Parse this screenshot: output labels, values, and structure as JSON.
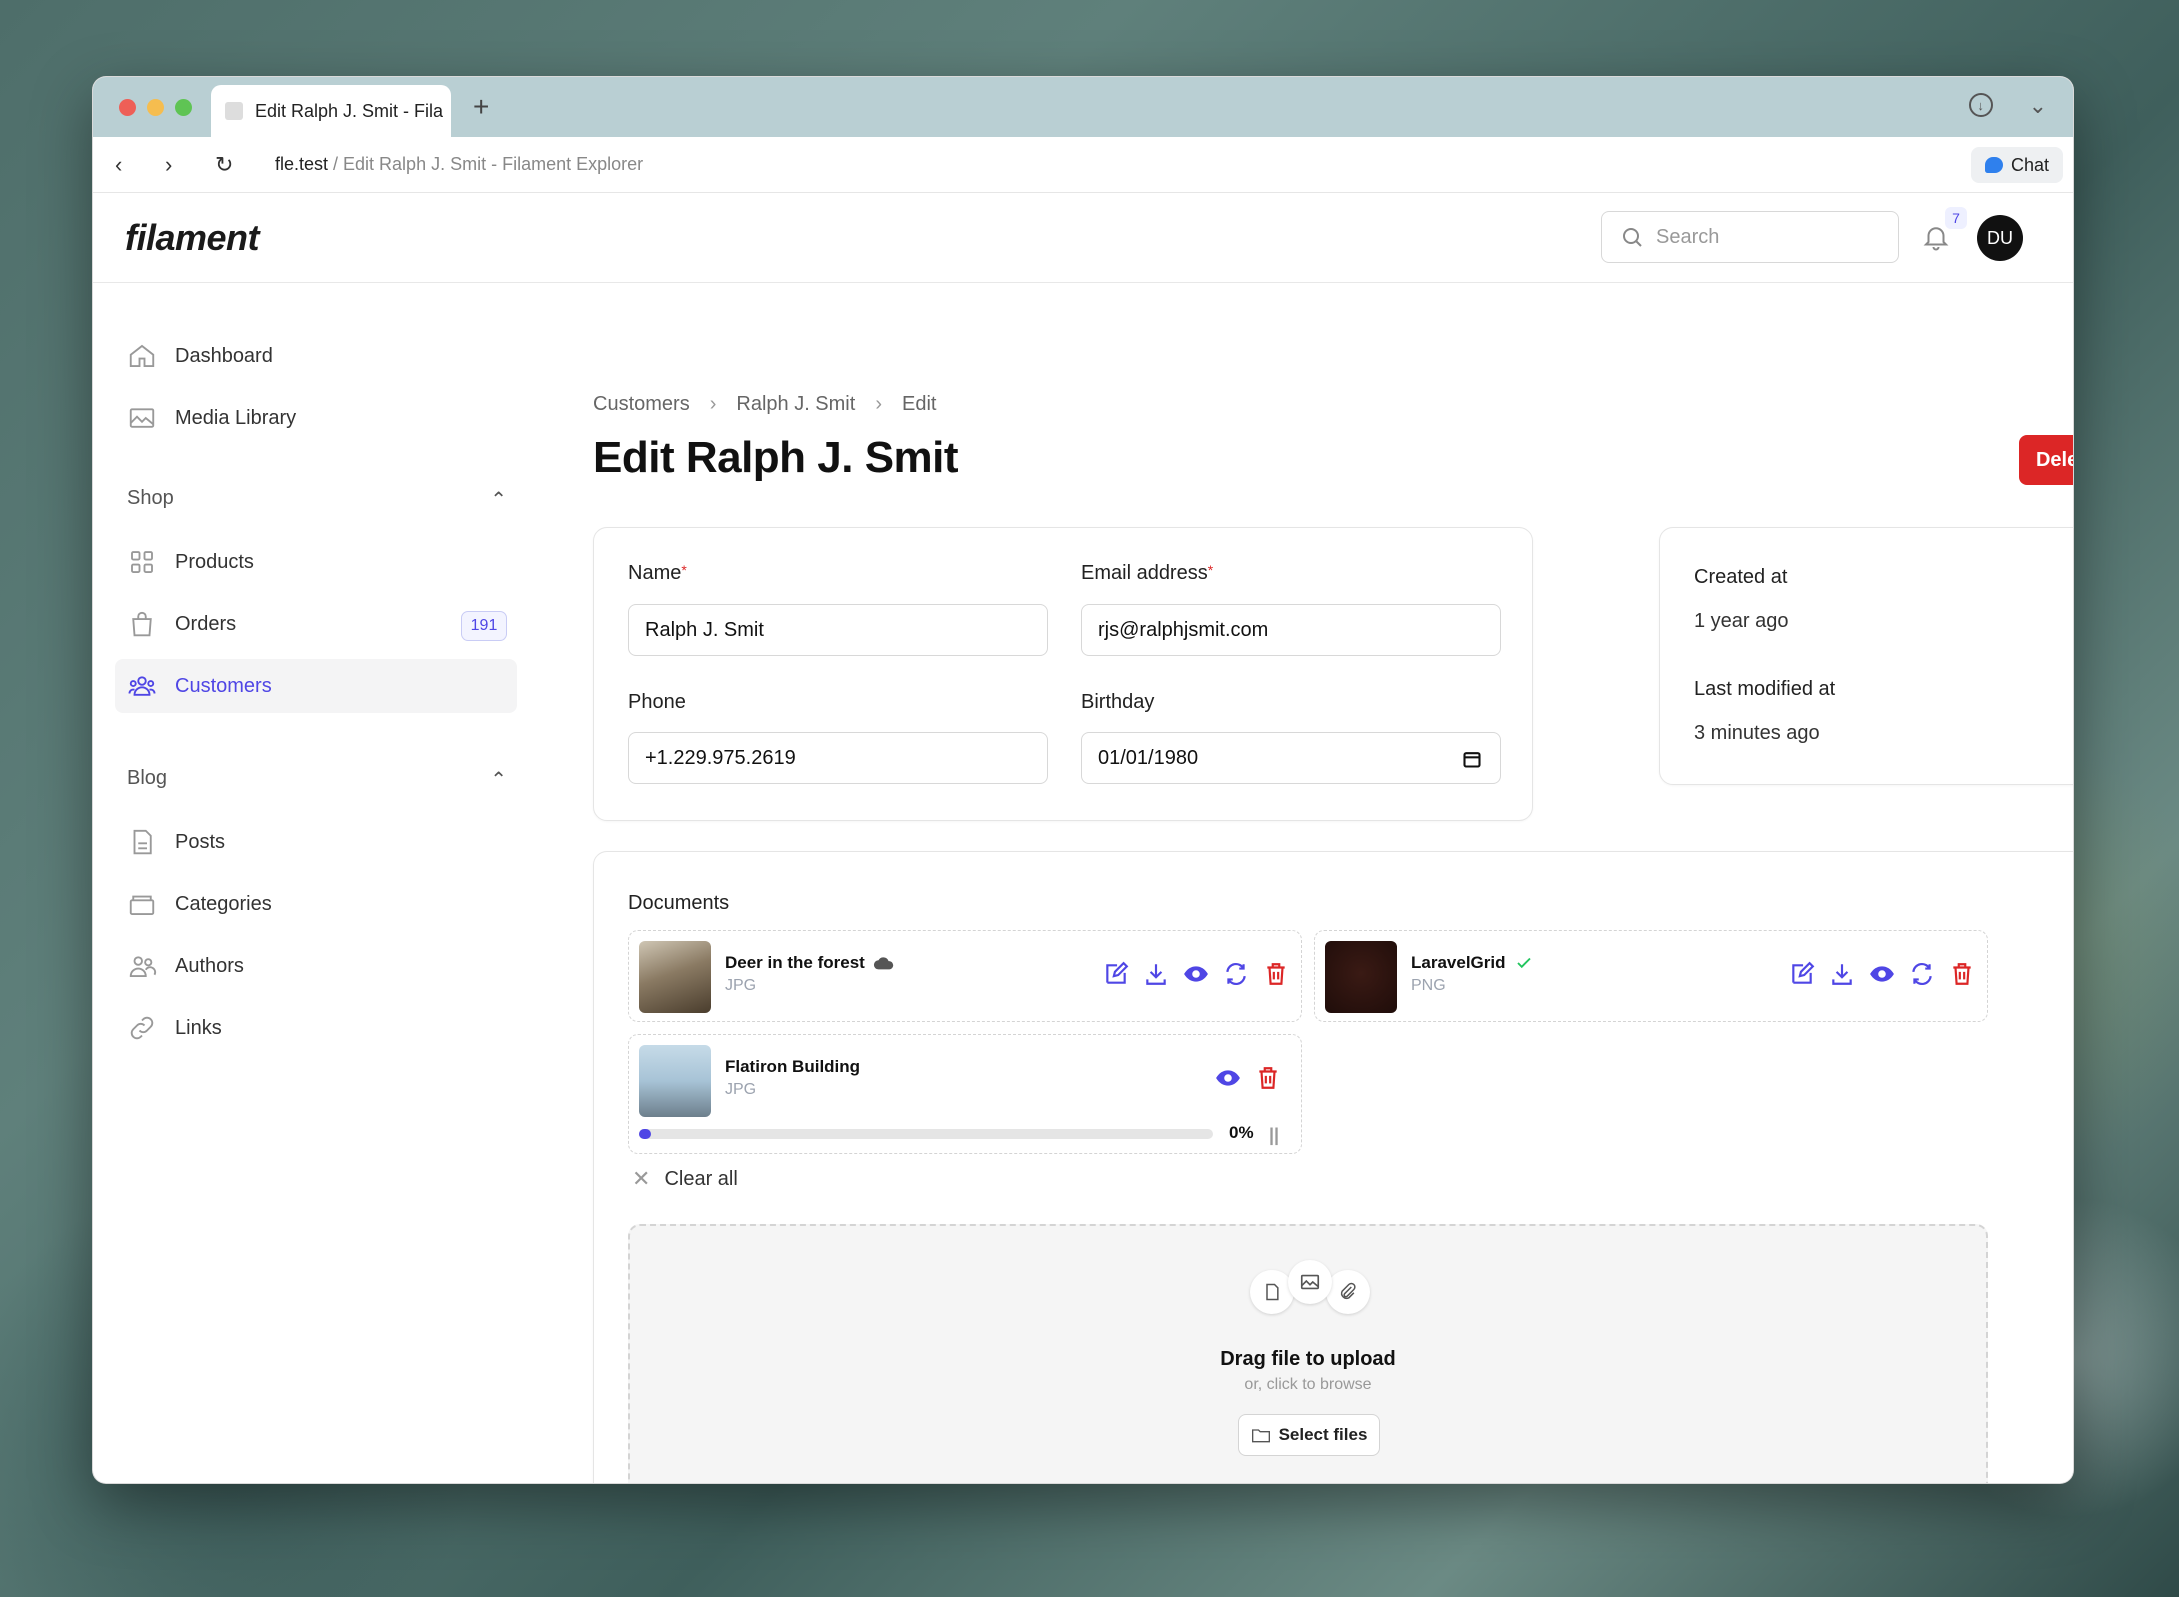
{
  "browser": {
    "tab_title": "Edit Ralph J. Smit - Fila",
    "url_host": "fle.test",
    "url_rest": " / Edit Ralph J. Smit - Filament Explorer",
    "chat_label": "Chat"
  },
  "app": {
    "logo": "filament",
    "search_placeholder": "Search",
    "notifications_count": "7",
    "avatar_initials": "DU"
  },
  "sidebar": {
    "top_items": [
      {
        "label": "Dashboard",
        "icon": "home-icon"
      },
      {
        "label": "Media Library",
        "icon": "image-icon"
      }
    ],
    "groups": [
      {
        "label": "Shop",
        "items": [
          {
            "label": "Products",
            "icon": "grid-icon"
          },
          {
            "label": "Orders",
            "icon": "bag-icon",
            "badge": "191"
          },
          {
            "label": "Customers",
            "icon": "users-icon",
            "active": true
          }
        ]
      },
      {
        "label": "Blog",
        "items": [
          {
            "label": "Posts",
            "icon": "document-icon"
          },
          {
            "label": "Categories",
            "icon": "folder-icon"
          },
          {
            "label": "Authors",
            "icon": "users-icon"
          },
          {
            "label": "Links",
            "icon": "link-icon"
          }
        ]
      }
    ]
  },
  "page": {
    "breadcrumbs": [
      "Customers",
      "Ralph J. Smit",
      "Edit"
    ],
    "title": "Edit Ralph J. Smit",
    "delete_label": "Delete"
  },
  "form": {
    "name_label": "Name",
    "name_value": "Ralph J. Smit",
    "email_label": "Email address",
    "email_value": "rjs@ralphjsmit.com",
    "phone_label": "Phone",
    "phone_value": "+1.229.975.2619",
    "birthday_label": "Birthday",
    "birthday_value": "01/01/1980",
    "required_mark": "*"
  },
  "info": {
    "created_label": "Created at",
    "created_value": "1 year ago",
    "modified_label": "Last modified at",
    "modified_value": "3 minutes ago"
  },
  "documents": {
    "label": "Documents",
    "files": [
      {
        "name": "Deer in the forest",
        "type": "JPG"
      },
      {
        "name": "LaravelGrid",
        "type": "PNG"
      },
      {
        "name": "Flatiron Building",
        "type": "JPG",
        "progress": "0%"
      }
    ],
    "clear_all": "Clear all",
    "drop_title": "Drag file to upload",
    "drop_sub": "or, click to browse",
    "select_files": "Select files"
  },
  "colors": {
    "primary": "#4f46e5",
    "danger": "#dc2626"
  }
}
